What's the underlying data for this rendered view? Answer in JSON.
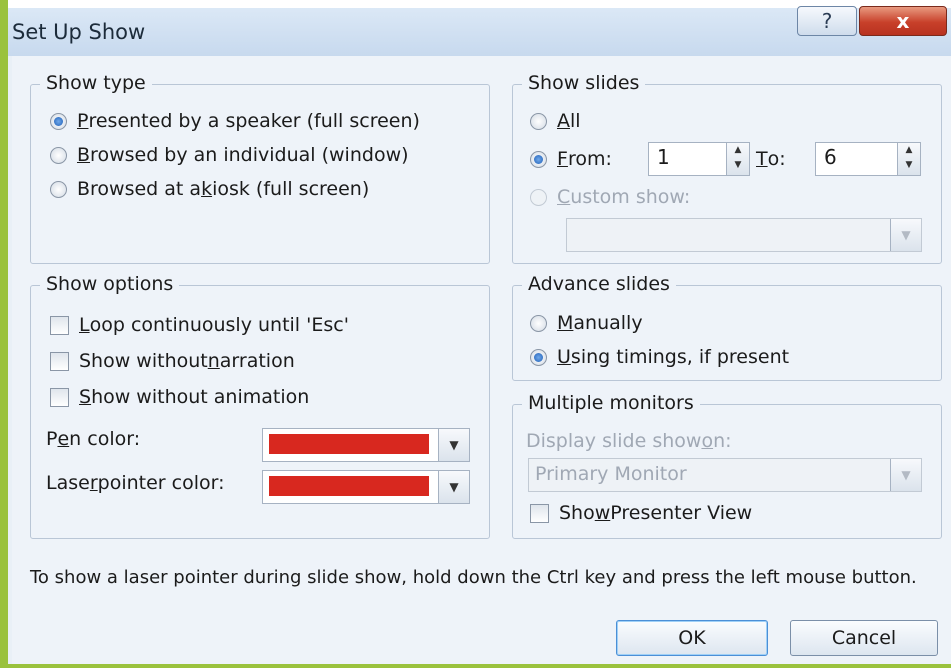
{
  "window": {
    "title": "Set Up Show",
    "help_label": "?",
    "close_label": "x"
  },
  "show_type": {
    "label": "Show type",
    "options": [
      {
        "pre": "",
        "key": "P",
        "post": "resented by a speaker (full screen)",
        "selected": true
      },
      {
        "pre": "",
        "key": "B",
        "post": "rowsed by an individual (window)",
        "selected": false
      },
      {
        "pre": "Browsed at a ",
        "key": "k",
        "post": "iosk (full screen)",
        "selected": false
      }
    ]
  },
  "show_slides": {
    "label": "Show slides",
    "all": {
      "pre": "",
      "key": "A",
      "post": "ll"
    },
    "from": {
      "pre": "",
      "key": "F",
      "post": "rom:",
      "value": "1"
    },
    "to": {
      "pre": "",
      "key": "T",
      "post": "o:",
      "value": "6"
    },
    "custom": {
      "pre": "",
      "key": "C",
      "post": "ustom show:"
    },
    "custom_value": ""
  },
  "show_options": {
    "label": "Show options",
    "checks": [
      {
        "pre": "",
        "key": "L",
        "post": "oop continuously until 'Esc'",
        "checked": false
      },
      {
        "pre": "Show without ",
        "key": "n",
        "post": "arration",
        "checked": false
      },
      {
        "pre": "",
        "key": "S",
        "post": "how without animation",
        "checked": false
      }
    ],
    "pen": {
      "pre": "P",
      "key": "e",
      "post": "n color:",
      "color": "#d8281f"
    },
    "laser": {
      "pre": "Lase",
      "key": "r",
      "post": " pointer color:",
      "color": "#d8281f"
    }
  },
  "advance_slides": {
    "label": "Advance slides",
    "manually": {
      "pre": "",
      "key": "M",
      "post": "anually",
      "selected": false
    },
    "timings": {
      "pre": "",
      "key": "U",
      "post": "sing timings, if present",
      "selected": true
    }
  },
  "monitors": {
    "label": "Multiple monitors",
    "display_label": {
      "pre": "Display slide show ",
      "key": "o",
      "post": "n:"
    },
    "display_value": "Primary Monitor",
    "presenter": {
      "pre": "Sho",
      "key": "w",
      "post": " Presenter View",
      "checked": false
    }
  },
  "note": "To show a laser pointer during slide show, hold down the Ctrl key and press the left mouse button.",
  "buttons": {
    "ok": "OK",
    "cancel": "Cancel"
  },
  "colors": {
    "accent": "#9ac23d",
    "pen": "#d8281f",
    "laser": "#d8281f"
  },
  "icons": {
    "spin": "spin-arrows-icon",
    "dropdown": "chevron-down-icon",
    "help": "question-mark-icon",
    "close": "close-icon"
  }
}
